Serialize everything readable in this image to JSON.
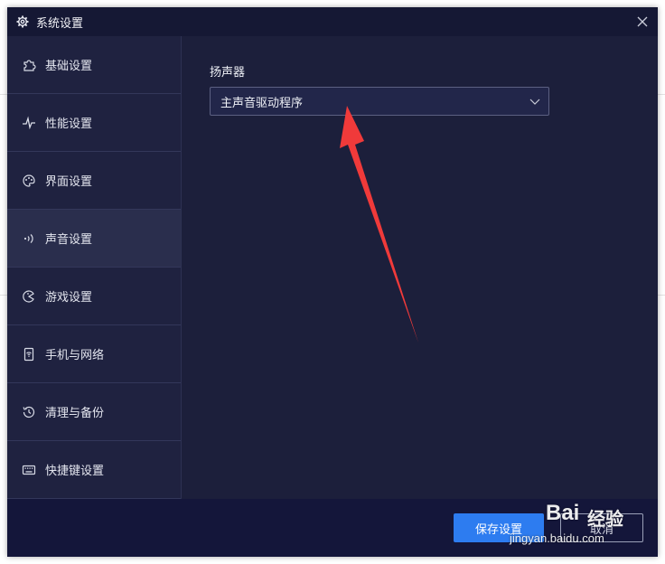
{
  "window": {
    "title": "系统设置"
  },
  "sidebar": {
    "items": [
      {
        "label": "基础设置",
        "icon": "puzzle-icon"
      },
      {
        "label": "性能设置",
        "icon": "pulse-icon"
      },
      {
        "label": "界面设置",
        "icon": "palette-icon"
      },
      {
        "label": "声音设置",
        "icon": "sound-wave-icon"
      },
      {
        "label": "游戏设置",
        "icon": "gamepad-icon"
      },
      {
        "label": "手机与网络",
        "icon": "phone-wifi-icon"
      },
      {
        "label": "清理与备份",
        "icon": "history-icon"
      },
      {
        "label": "快捷键设置",
        "icon": "keyboard-icon"
      }
    ],
    "active_index": 3
  },
  "content": {
    "speaker_label": "扬声器",
    "speaker_select": {
      "value": "主声音驱动程序"
    }
  },
  "footer": {
    "save_label": "保存设置",
    "cancel_label": "取消"
  },
  "watermark": {
    "brand": "Bai",
    "brand_cn": "经验",
    "url": "jingyan.baidu.com"
  },
  "colors": {
    "dialog_bg": "#1c1f3b",
    "accent": "#2d7cf0",
    "annotation_arrow": "#f03a3a"
  }
}
